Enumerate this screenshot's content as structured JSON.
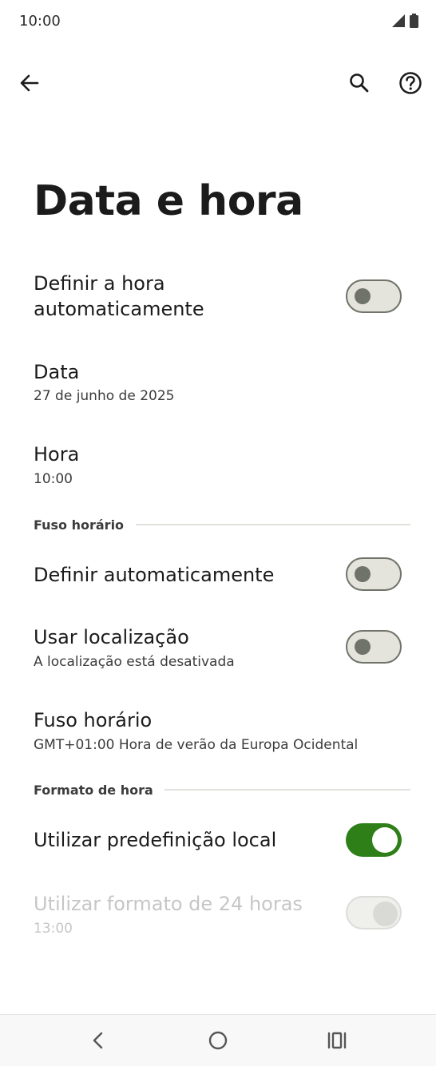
{
  "status": {
    "time": "10:00"
  },
  "header": {
    "title": "Data e hora"
  },
  "auto_time": {
    "label_line1": "Definir a hora",
    "label_line2": "automaticamente",
    "enabled": false
  },
  "date": {
    "label": "Data",
    "value": "27 de junho de 2025"
  },
  "time": {
    "label": "Hora",
    "value": "10:00"
  },
  "timezone_section": {
    "header": "Fuso horário",
    "auto": {
      "label": "Definir automaticamente",
      "enabled": false
    },
    "location": {
      "label": "Usar localização",
      "sub": "A localização está desativada",
      "enabled": false
    },
    "zone": {
      "label": "Fuso horário",
      "value": "GMT+01:00 Hora de verão da Europa Ocidental"
    }
  },
  "format_section": {
    "header": "Formato de hora",
    "locale_default": {
      "label": "Utilizar predefinição local",
      "enabled": true
    },
    "format_24h": {
      "label": "Utilizar formato de 24 horas",
      "sub": "13:00",
      "enabled": true,
      "disabled": true
    }
  },
  "colors": {
    "accent": "#2e7f17",
    "toggle_off_bg": "#e4e4dc",
    "toggle_off_border": "#6f7369"
  },
  "icons": [
    "signal-icon",
    "battery-icon",
    "back-arrow-icon",
    "search-icon",
    "help-icon",
    "nav-back-icon",
    "nav-home-icon",
    "nav-recents-icon"
  ]
}
